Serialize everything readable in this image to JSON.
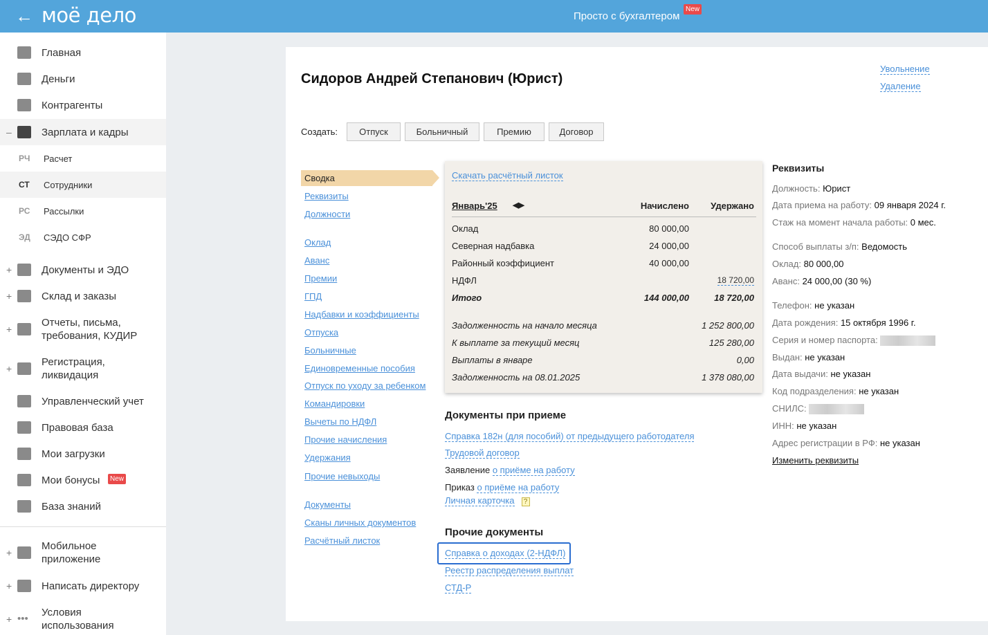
{
  "header": {
    "logo": "моё дело",
    "promo": "Просто с бухгалтером",
    "new_badge": "New"
  },
  "sidebar": {
    "items": [
      {
        "label": "Главная"
      },
      {
        "label": "Деньги"
      },
      {
        "label": "Контрагенты"
      },
      {
        "label": "Зарплата и кадры"
      }
    ],
    "sub": [
      {
        "abbr": "РЧ",
        "label": "Расчет"
      },
      {
        "abbr": "СТ",
        "label": "Сотрудники"
      },
      {
        "abbr": "РС",
        "label": "Рассылки"
      },
      {
        "abbr": "ЭД",
        "label": "СЭДО СФР"
      }
    ],
    "items2": [
      {
        "label": "Документы и ЭДО"
      },
      {
        "label": "Склад и заказы"
      },
      {
        "label": "Отчеты, письма, требования, КУДИР"
      },
      {
        "label": "Регистрация, ликвидация"
      },
      {
        "label": "Управленческий учет"
      },
      {
        "label": "Правовая база"
      },
      {
        "label": "Мои загрузки"
      },
      {
        "label": "Мои бонусы",
        "badge": "New"
      },
      {
        "label": "База знаний"
      }
    ],
    "bottom": [
      {
        "label": "Мобильное приложение"
      },
      {
        "label": "Написать директору"
      },
      {
        "label": "Условия использования"
      }
    ]
  },
  "employee": {
    "title": "Сидоров Андрей Степанович (Юрист)",
    "dismiss": "Увольнение",
    "delete": "Удаление"
  },
  "create": {
    "label": "Создать:",
    "buttons": [
      "Отпуск",
      "Больничный",
      "Премию",
      "Договор"
    ]
  },
  "nav": {
    "active": "Сводка",
    "items": [
      "Реквизиты",
      "Должности",
      "Оклад",
      "Аванс",
      "Премии",
      "ГПД",
      "Надбавки и коэффициенты",
      "Отпуска",
      "Больничные",
      "Единовременные пособия",
      "Отпуск по уходу за ребенком",
      "Командировки",
      "Вычеты по НДФЛ",
      "Прочие начисления",
      "Удержания",
      "Прочие невыходы",
      "Документы",
      "Сканы личных документов",
      "Расчётный листок"
    ]
  },
  "summary": {
    "download": "Скачать расчётный листок",
    "period": "Январь'25",
    "col1": "Начислено",
    "col2": "Удержано",
    "rows": [
      {
        "name": "Оклад",
        "accrued": "80 000,00",
        "withheld": ""
      },
      {
        "name": "Северная надбавка",
        "accrued": "24 000,00",
        "withheld": ""
      },
      {
        "name": "Районный коэффициент",
        "accrued": "40 000,00",
        "withheld": ""
      },
      {
        "name": "НДФЛ",
        "accrued": "",
        "withheld": "18 720,00"
      }
    ],
    "total": {
      "name": "Итого",
      "accrued": "144 000,00",
      "withheld": "18 720,00"
    },
    "debts": [
      {
        "name": "Задолженность на начало месяца",
        "value": "1 252 800,00"
      },
      {
        "name": "К выплате за текущий месяц",
        "value": "125 280,00"
      },
      {
        "name": "Выплаты в январе",
        "value": "0,00"
      },
      {
        "name": "Задолженность на 08.01.2025",
        "value": "1 378 080,00"
      }
    ]
  },
  "docs_hire": {
    "title": "Документы при приеме",
    "l1": "Справка 182н (для пособий) от предыдущего работодателя",
    "l2": "Трудовой договор",
    "p3": "Заявление",
    "l3": "о приёме на работу",
    "p4": "Приказ",
    "l4": "о приёме на работу",
    "l5": "Личная карточка",
    "help": "?"
  },
  "docs_other": {
    "title": "Прочие документы",
    "items": [
      "Справка о доходах (2-НДФЛ)",
      "Реестр распределения выплат",
      "СТД-Р"
    ]
  },
  "requisites": {
    "title": "Реквизиты",
    "fields": [
      [
        "Должность:",
        "Юрист"
      ],
      [
        "Дата приема на работу:",
        "09 января 2024 г."
      ],
      [
        "Стаж на момент начала работы:",
        "0 мес."
      ],
      [
        "Способ выплаты з/п:",
        "Ведомость"
      ],
      [
        "Оклад:",
        "80 000,00"
      ],
      [
        "Аванс:",
        "24 000,00 (30 %)"
      ],
      [
        "Телефон:",
        "не указан"
      ],
      [
        "Дата рождения:",
        "15 октября 1996 г."
      ],
      [
        "Серия и номер паспорта:",
        ""
      ],
      [
        "Выдан:",
        "не указан"
      ],
      [
        "Дата выдачи:",
        "не указан"
      ],
      [
        "Код подразделения:",
        "не указан"
      ],
      [
        "СНИЛС:",
        ""
      ],
      [
        "ИНН:",
        "не указан"
      ],
      [
        "Адрес регистрации в РФ:",
        "не указан"
      ]
    ],
    "edit": "Изменить реквизиты"
  }
}
